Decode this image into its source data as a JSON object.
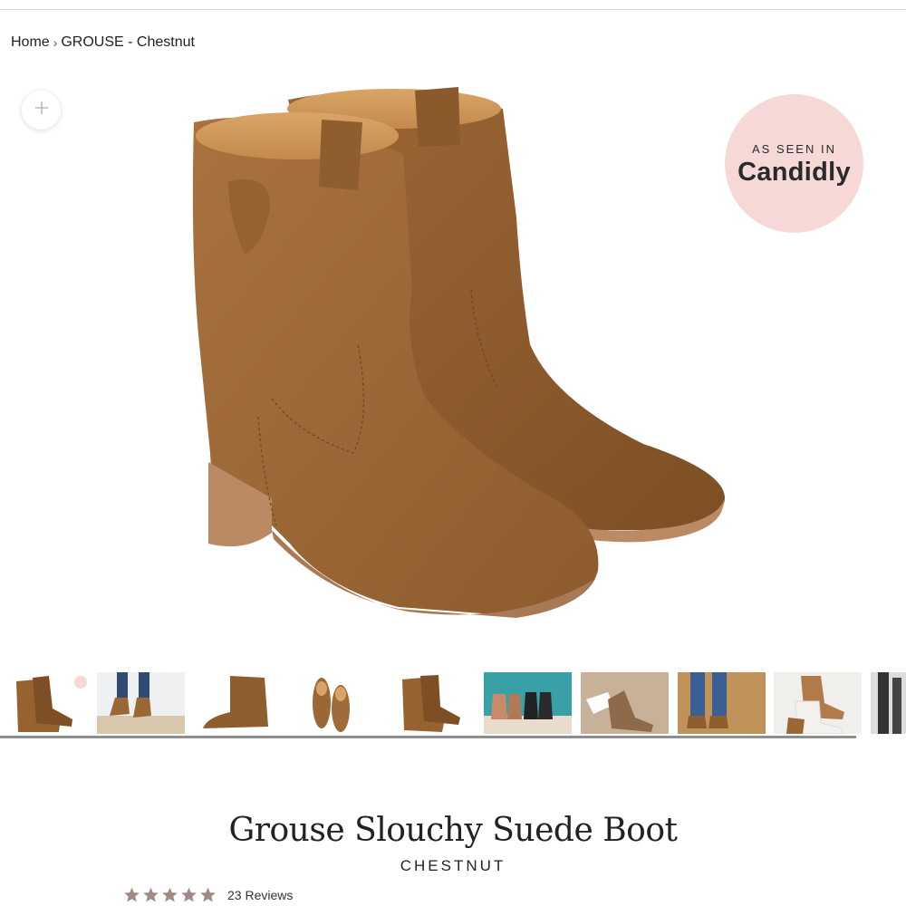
{
  "breadcrumb": {
    "home": "Home",
    "separator": "›",
    "current": "GROUSE - Chestnut"
  },
  "zoom": {
    "icon": "plus-icon"
  },
  "badge": {
    "top_text": "AS SEEN IN",
    "brand": "Candidly",
    "color": "#f6d9d7"
  },
  "gallery": {
    "thumbnails": [
      {
        "label": "boots-pair-side"
      },
      {
        "label": "boots-worn-with-jeans"
      },
      {
        "label": "boot-side-profile"
      },
      {
        "label": "boots-top-view"
      },
      {
        "label": "boots-pair-angle"
      },
      {
        "label": "boots-three-colors"
      },
      {
        "label": "boot-foot-lifestyle"
      },
      {
        "label": "boots-cropped-jeans"
      },
      {
        "label": "boots-white-and-brown"
      },
      {
        "label": "boots-legs-partial"
      }
    ]
  },
  "product": {
    "title": "Grouse Slouchy Suede Boot",
    "color_name": "CHESTNUT",
    "rating": 5,
    "rating_max": 5,
    "reviews_text": "23 Reviews",
    "star_color": "#a08a85"
  },
  "colors": {
    "suede": "#a06a3a",
    "sole": "#b98a64"
  }
}
